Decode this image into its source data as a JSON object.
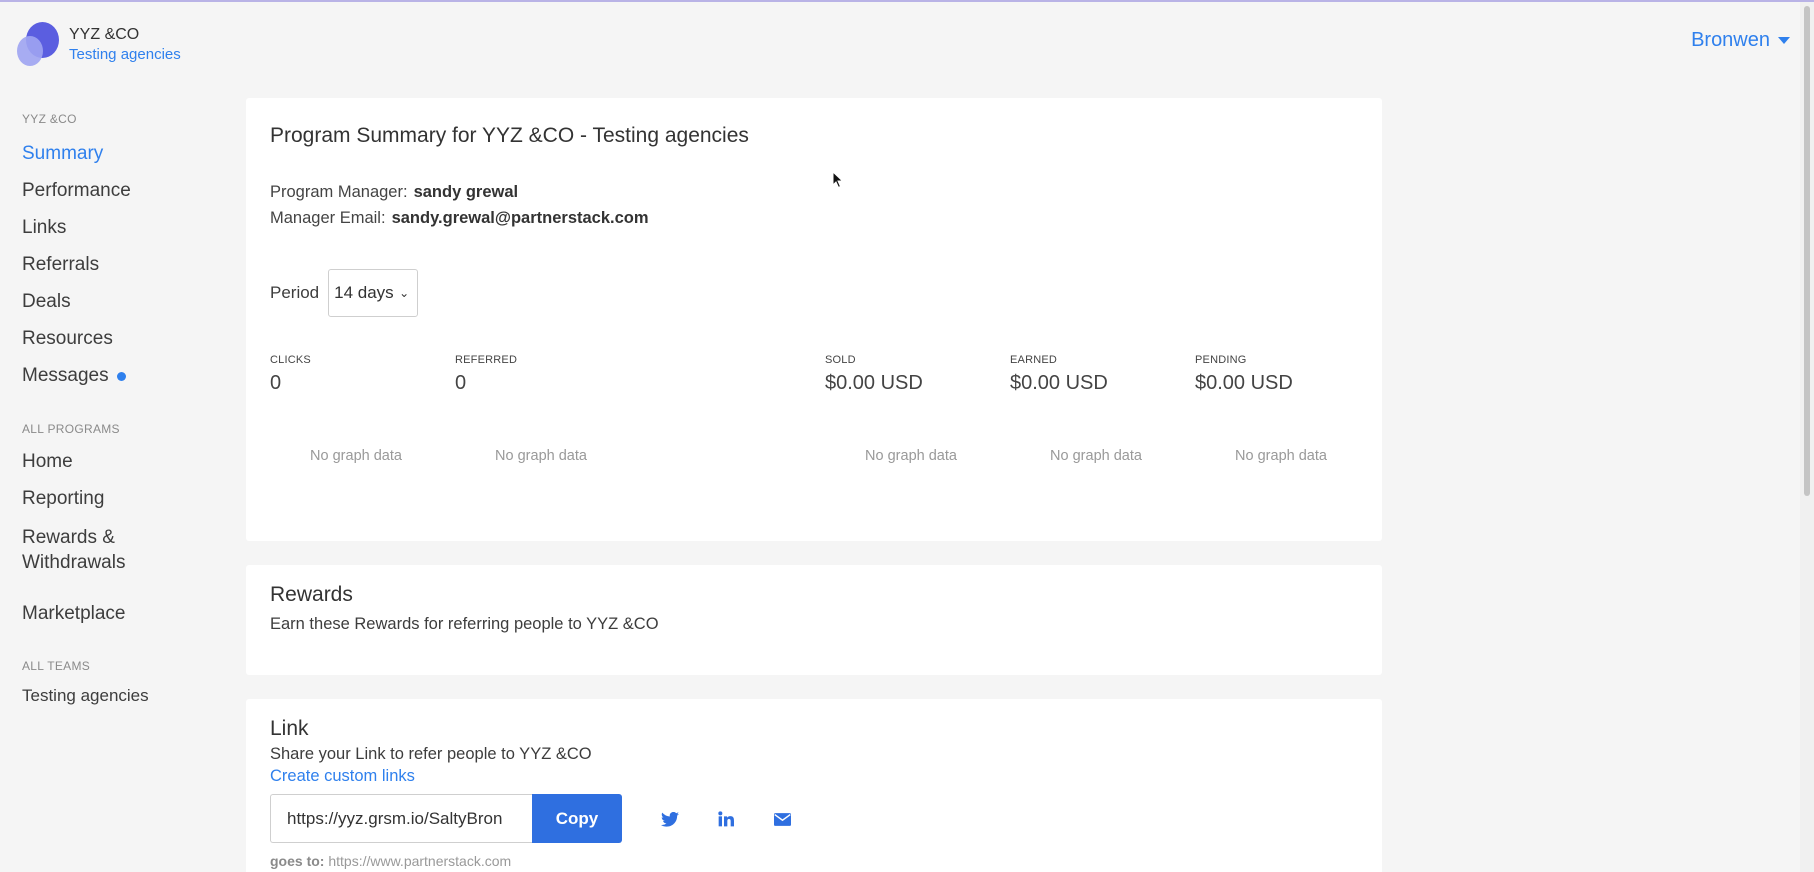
{
  "brand": {
    "name": "YYZ &CO",
    "subtitle": "Testing agencies"
  },
  "user": {
    "name": "Bronwen"
  },
  "sidebar": {
    "section1_heading": "YYZ &CO",
    "section1_items": [
      {
        "label": "Summary"
      },
      {
        "label": "Performance"
      },
      {
        "label": "Links"
      },
      {
        "label": "Referrals"
      },
      {
        "label": "Deals"
      },
      {
        "label": "Resources"
      },
      {
        "label": "Messages"
      }
    ],
    "section2_heading": "ALL PROGRAMS",
    "section2_items": [
      {
        "label": "Home"
      },
      {
        "label": "Reporting"
      },
      {
        "label": "Rewards &"
      },
      {
        "label": "Withdrawals"
      },
      {
        "label": "Marketplace"
      }
    ],
    "section3_heading": "ALL TEAMS",
    "section3_items": [
      {
        "label": "Testing agencies"
      }
    ]
  },
  "summary": {
    "title": "Program Summary for YYZ &CO - Testing agencies",
    "manager_label": "Program Manager:",
    "manager_name": "sandy grewal",
    "email_label": "Manager Email:",
    "email_value": "sandy.grewal@partnerstack.com",
    "period_label": "Period",
    "period_value": "14 days",
    "stats": [
      {
        "label": "CLICKS",
        "value": "0"
      },
      {
        "label": "REFERRED",
        "value": "0"
      },
      {
        "label": "SOLD",
        "value": "$0.00 USD"
      },
      {
        "label": "EARNED",
        "value": "$0.00 USD"
      },
      {
        "label": "PENDING",
        "value": "$0.00 USD"
      }
    ],
    "no_graph_text": "No graph data"
  },
  "rewards": {
    "title": "Rewards",
    "text": "Earn these Rewards for referring people to YYZ &CO"
  },
  "link": {
    "title": "Link",
    "text": "Share your Link to refer people to YYZ &CO",
    "custom_link_label": "Create custom links",
    "url_value": "https://yyz.grsm.io/SaltyBron",
    "copy_label": "Copy",
    "goes_to_label": "goes to:",
    "goes_to_url": "https://www.partnerstack.com"
  },
  "icons": [
    "twitter-icon",
    "linkedin-icon",
    "email-icon",
    "chevron-down-icon"
  ],
  "colors": {
    "accent": "#2f80ed",
    "button": "#2f6fe0",
    "logo": "#5b5ee0"
  }
}
